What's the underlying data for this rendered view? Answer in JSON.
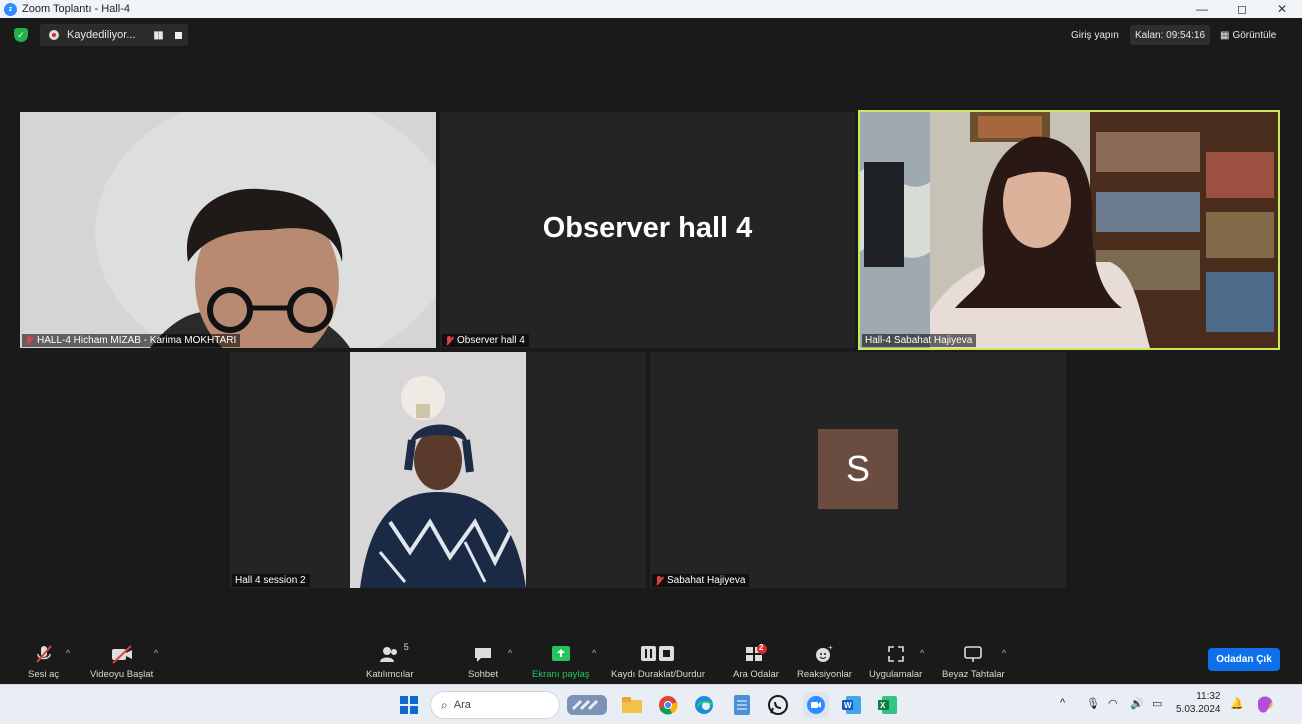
{
  "window": {
    "title": "Zoom Toplantı - Hall-4",
    "minimize": "—",
    "restore": "◻",
    "close": "✕"
  },
  "topbar": {
    "recording_label": "Kaydediliyor...",
    "sign_in": "Giriş yapın",
    "time_left": "Kalan: 09:54:16",
    "view_label": "Görüntüle"
  },
  "tiles": [
    {
      "name": "HALL-4  Hicham MIZAB - Karima MOKHTARI",
      "muted": true
    },
    {
      "name": "Observer hall 4",
      "muted": true,
      "display_name": "Observer hall 4"
    },
    {
      "name": "Hall-4 Sabahat Hajiyeva",
      "muted": false,
      "active_speaker": true
    },
    {
      "name": "Hall 4 session 2",
      "muted": false
    },
    {
      "name": "Sabahat Hajiyeva",
      "muted": true,
      "avatar_letter": "S"
    }
  ],
  "toolbar": {
    "mute": "Sesi aç",
    "video": "Videoyu Başlat",
    "participants": "Katılımcılar",
    "participants_count": "5",
    "chat": "Sohbet",
    "share": "Ekranı paylaş",
    "record": "Kaydı Duraklat/Durdur",
    "breakout": "Ara Odalar",
    "breakout_badge": "2",
    "reactions": "Reaksiyonlar",
    "apps": "Uygulamalar",
    "whiteboard": "Beyaz Tahtalar",
    "leave": "Odadan Çık"
  },
  "taskbar": {
    "search_placeholder": "Ara",
    "time": "11:32",
    "date": "5.03.2024"
  },
  "colors": {
    "accent": "#0e71eb",
    "active_speaker_border": "#c9e85a",
    "share_green": "#22c55e",
    "muted_red": "#e04040"
  }
}
